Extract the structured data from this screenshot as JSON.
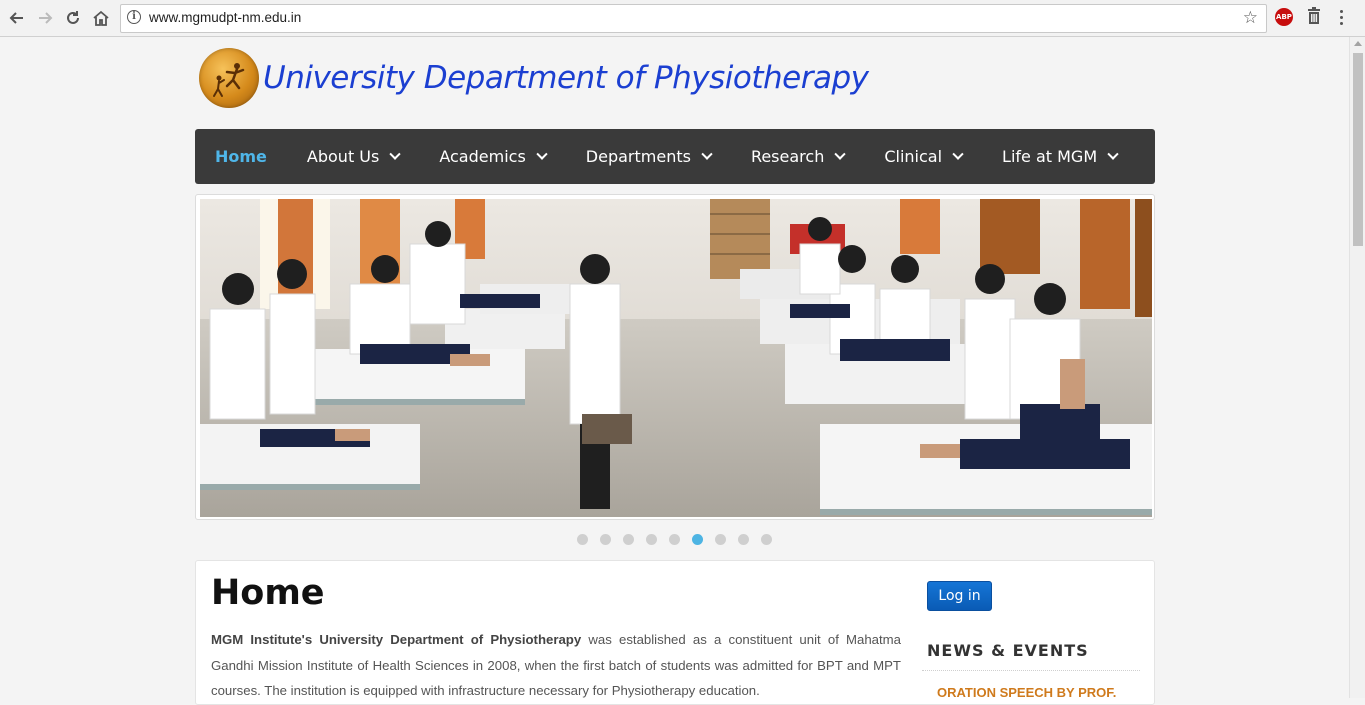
{
  "browser": {
    "url": "www.mgmudpt-nm.edu.in",
    "back_icon": "back-arrow-icon",
    "forward_icon": "forward-arrow-icon",
    "reload_icon": "reload-icon",
    "home_icon": "home-icon",
    "info_glyph": "i",
    "bookmark_glyph": "☆",
    "extension_label": "ABP"
  },
  "site": {
    "title": "University Department of Physiotherapy",
    "title_color": "#1b3fd1"
  },
  "nav": {
    "items": [
      {
        "label": "Home",
        "active": true
      },
      {
        "label": "About Us"
      },
      {
        "label": "Academics"
      },
      {
        "label": "Departments"
      },
      {
        "label": "Research"
      },
      {
        "label": "Clinical"
      },
      {
        "label": "Life at MGM"
      }
    ],
    "active_color": "#4fb6e9"
  },
  "slider": {
    "slide_count": 9,
    "active_index": 5,
    "active_color": "#4db4e3"
  },
  "main": {
    "heading": "Home",
    "intro_bold": "MGM Institute's University Department of Physiotherapy",
    "intro_rest": " was established as a constituent unit of Mahatma Gandhi Mission Institute of Health Sciences in 2008, when the first batch of students was admitted for BPT and MPT courses. The institution is equipped with infrastructure necessary for Physiotherapy education."
  },
  "sidebar": {
    "login_label": "Log in",
    "news_heading": "NEWS & EVENTS",
    "news_items": [
      "ORATION SPEECH BY PROF."
    ],
    "news_color": "#cf7a1c"
  }
}
